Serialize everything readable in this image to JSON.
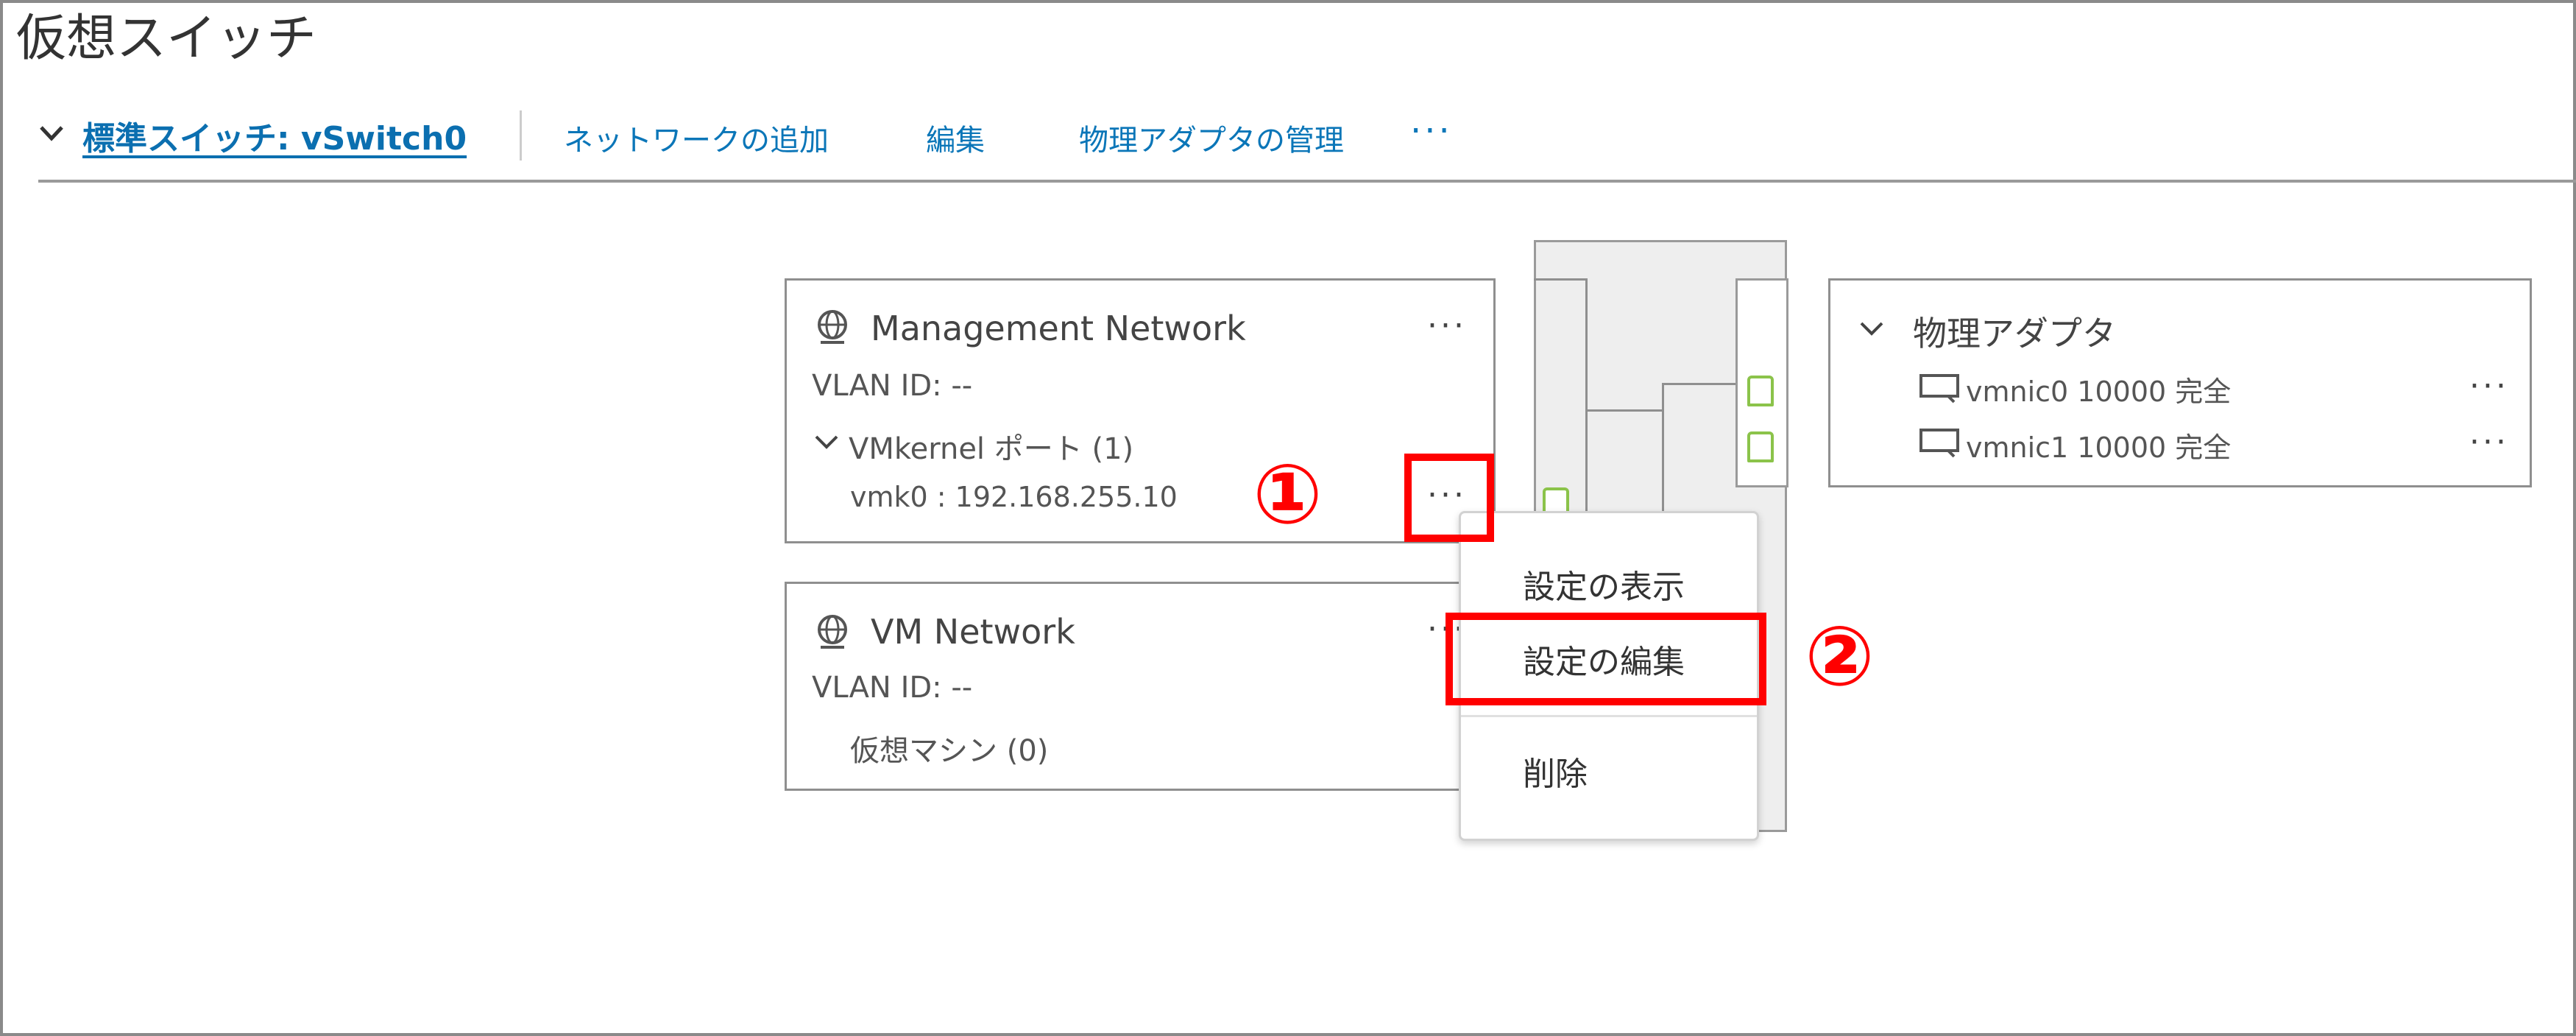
{
  "page": {
    "title": "仮想スイッチ"
  },
  "toolbar": {
    "switch_label": "標準スイッチ: vSwitch0",
    "add_network": "ネットワークの追加",
    "edit": "編集",
    "manage_adapters": "物理アダプタの管理",
    "more": "···"
  },
  "management_network": {
    "name": "Management Network",
    "vlan": "VLAN ID: --",
    "group_label": "VMkernel ポート (1)",
    "vmk_item": "vmk0 : 192.168.255.10",
    "more": "···"
  },
  "vm_network": {
    "name": "VM Network",
    "vlan": "VLAN ID: --",
    "vm_label": "仮想マシン (0)",
    "more": "···"
  },
  "physical_adapters": {
    "title": "物理アダプタ",
    "items": [
      {
        "label": "vmnic0 10000 完全",
        "more": "···"
      },
      {
        "label": "vmnic1 10000 完全",
        "more": "···"
      }
    ]
  },
  "context_menu": {
    "items": [
      "設定の表示",
      "設定の編集",
      "削除"
    ]
  },
  "annotations": {
    "step1": "①",
    "step2": "②"
  },
  "colors": {
    "link": "#0b76b8",
    "annotation": "#ff0000",
    "port_icon": "#8bc34a"
  },
  "icons": {
    "collapse": "chevron-down-icon",
    "network": "network-globe-icon",
    "adapter": "nic-icon"
  }
}
